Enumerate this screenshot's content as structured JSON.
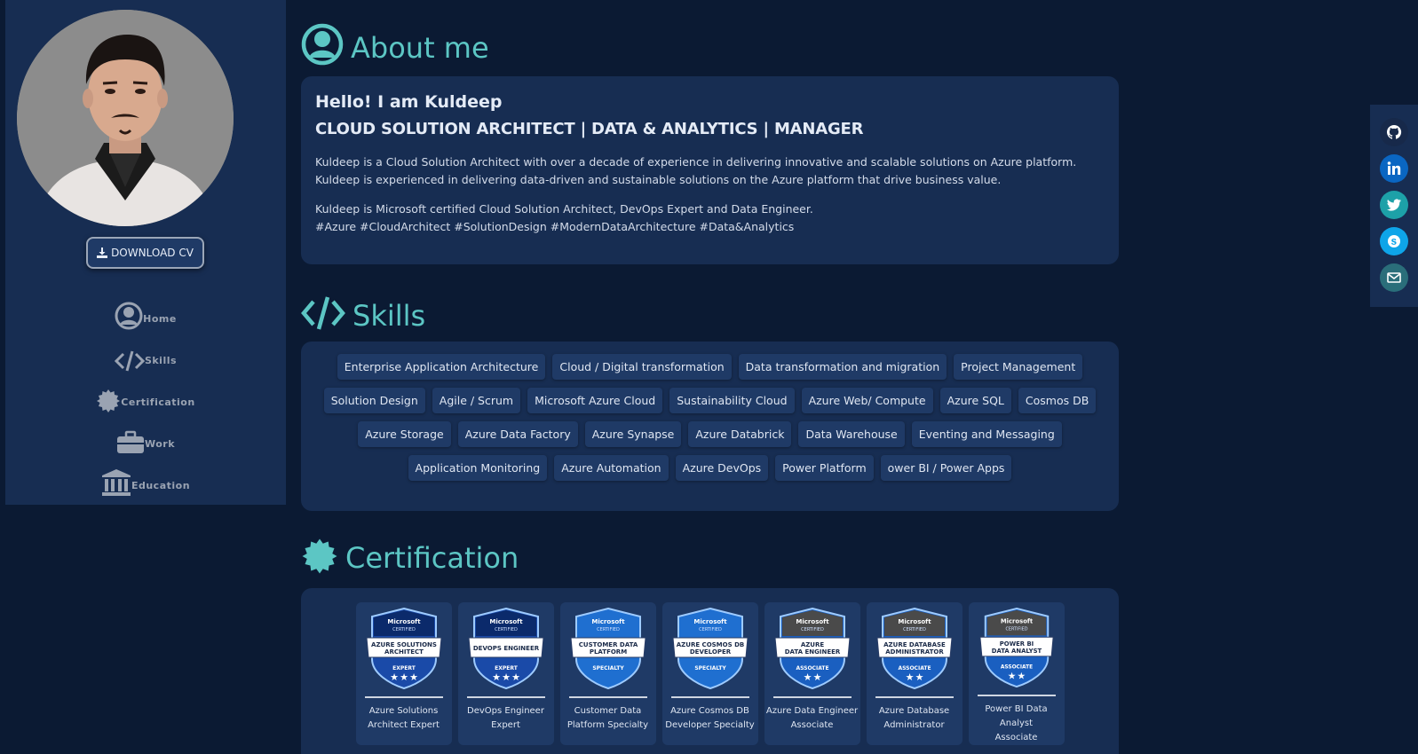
{
  "sidebar": {
    "download_label": "DOWNLOAD CV",
    "nav": [
      {
        "label": "Home",
        "icon": "user-circle-icon"
      },
      {
        "label": "Skills",
        "icon": "code-icon"
      },
      {
        "label": "Certification",
        "icon": "certificate-icon"
      },
      {
        "label": "Work",
        "icon": "briefcase-icon"
      },
      {
        "label": "Education",
        "icon": "university-icon"
      }
    ]
  },
  "about": {
    "title": "About me",
    "greeting": "Hello! I am Kuldeep",
    "headline": "CLOUD SOLUTION ARCHITECT | DATA & ANALYTICS | MANAGER",
    "para1": "Kuldeep is a Cloud Solution Architect with over a decade of experience in delivering innovative and scalable solutions on Azure platform. Kuldeep is experienced in delivering data-driven and sustainable solutions on the Azure platform that drive business value.",
    "para2_line1": "Kuldeep is Microsoft certified Cloud Solution Architect, DevOps Expert and Data Engineer.",
    "para2_line2": "#Azure #CloudArchitect #SolutionDesign #ModernDataArchitecture #Data&Analytics"
  },
  "skills": {
    "title": "Skills",
    "rows": [
      [
        "Enterprise Application Architecture",
        "Cloud / Digital transformation",
        "Data transformation and migration",
        "Project Management"
      ],
      [
        "Solution Design",
        "Agile / Scrum",
        "Microsoft Azure Cloud",
        "Sustainability Cloud",
        "Azure Web/ Compute",
        "Azure SQL",
        "Cosmos DB"
      ],
      [
        "Azure Storage",
        "Azure Data Factory",
        "Azure Synapse",
        "Azure Databrick",
        "Data Warehouse",
        "Eventing and Messaging"
      ],
      [
        "Application Monitoring",
        "Azure Automation",
        "Azure DevOps",
        "Power Platform",
        "owe​r BI / Power Apps"
      ]
    ]
  },
  "certification": {
    "title": "Certification",
    "items": [
      {
        "name_line1": "Azure Solutions",
        "name_line2": "Architect Expert",
        "badge_top": "Microsoft",
        "badge_sub": "CERTIFIED",
        "badge_name1": "AZURE SOLUTIONS",
        "badge_name2": "ARCHITECT",
        "badge_level": "EXPERT",
        "stars": 3,
        "top_color": "#0b2a6b",
        "ribbon_color": "#1a4aa8"
      },
      {
        "name_line1": "DevOps Engineer",
        "name_line2": "Expert",
        "badge_top": "Microsoft",
        "badge_sub": "CERTIFIED",
        "badge_name1": "DEVOPS ENGINEER",
        "badge_name2": "",
        "badge_level": "EXPERT",
        "stars": 3,
        "top_color": "#0b2a6b",
        "ribbon_color": "#1a4aa8"
      },
      {
        "name_line1": "Customer Data",
        "name_line2": "Platform Specialty",
        "badge_top": "Microsoft",
        "badge_sub": "CERTIFIED",
        "badge_name1": "CUSTOMER DATA",
        "badge_name2": "PLATFORM",
        "badge_level": "SPECIALTY",
        "stars": 0,
        "top_color": "#1f6fd0",
        "ribbon_color": "#1f6fd0"
      },
      {
        "name_line1": "Azure Cosmos DB",
        "name_line2": "Developer Specialty",
        "badge_top": "Microsoft",
        "badge_sub": "CERTIFIED",
        "badge_name1": "AZURE COSMOS DB",
        "badge_name2": "DEVELOPER",
        "badge_level": "SPECIALTY",
        "stars": 0,
        "top_color": "#1f6fd0",
        "ribbon_color": "#1f6fd0"
      },
      {
        "name_line1": "Azure Data Engineer",
        "name_line2": "Associate",
        "badge_top": "Microsoft",
        "badge_sub": "CERTIFIED",
        "badge_name1": "AZURE",
        "badge_name2": "DATA ENGINEER",
        "badge_level": "ASSOCIATE",
        "stars": 2,
        "top_color": "#4a4a4a",
        "ribbon_color": "#1a5fc0"
      },
      {
        "name_line1": "Azure Database",
        "name_line2": "Administrator",
        "badge_top": "Microsoft",
        "badge_sub": "CERTIFIED",
        "badge_name1": "AZURE DATABASE",
        "badge_name2": "ADMINISTRATOR",
        "badge_level": "ASSOCIATE",
        "stars": 2,
        "top_color": "#4a4a4a",
        "ribbon_color": "#1a5fc0"
      },
      {
        "name_line1": "Power BI Data Analyst",
        "name_line2": "Associate",
        "badge_top": "Microsoft",
        "badge_sub": "CERTIFIED",
        "badge_name1": "POWER BI",
        "badge_name2": "DATA ANALYST",
        "badge_level": "ASSOCIATE",
        "stars": 2,
        "top_color": "#4a4a4a",
        "ribbon_color": "#1a5fc0"
      }
    ]
  },
  "social": [
    {
      "icon": "github-icon",
      "bg": "#17294a"
    },
    {
      "icon": "linkedin-icon",
      "bg": "#0a66c2"
    },
    {
      "icon": "twitter-icon",
      "bg": "#1da1a8"
    },
    {
      "icon": "skype-icon",
      "bg": "#0ea5e9"
    },
    {
      "icon": "mail-icon",
      "bg": "#2a6e7a"
    }
  ],
  "colors": {
    "accent": "#5cc6c4",
    "bg": "#0b1a33",
    "panel": "#172d52",
    "chip": "#1f3a66"
  }
}
